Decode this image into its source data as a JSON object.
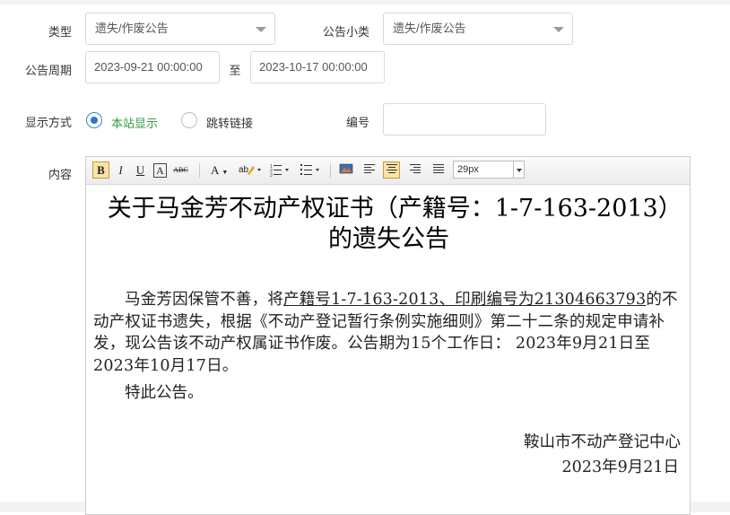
{
  "form": {
    "type_label": "类型",
    "type_value": "遗失/作废公告",
    "subtype_label": "公告小类",
    "subtype_value": "遗失/作废公告",
    "period_label": "公告周期",
    "period_start": "2023-09-21 00:00:00",
    "period_to": "至",
    "period_end": "2023-10-17 00:00:00",
    "display_label": "显示方式",
    "display_options": [
      "本站显示",
      "跳转链接"
    ],
    "display_selected": "本站显示",
    "number_label": "编号",
    "number_value": "",
    "content_label": "内容"
  },
  "toolbar": {
    "bold": "B",
    "italic": "I",
    "underline": "U",
    "font": "A",
    "strike": "ABC",
    "font_color": "A",
    "font_size": "29px"
  },
  "document": {
    "title": "关于马金芳不动产权证书（产籍号：1-7-163-2013）的遗失公告",
    "para_a": "马金芳因保管不善，将",
    "para_u": "产籍号1-7-163-2013、印刷编号为21304663793",
    "para_b": "的不动产权证书遗失，根据《不动产登记暂行条例实施细则》第二十二条的规定申请补发，现公告该不动产权属证书作废。公告期为15个工作日：  2023年9月21日至2023年10月17日。",
    "para2": "特此公告。",
    "signer": "鞍山市不动产登记中心",
    "date": "2023年9月21日"
  },
  "colors": {
    "accent": "#2f74d1",
    "selected_text": "#2e9a43",
    "active_button_bg": "#f9e3a8"
  }
}
